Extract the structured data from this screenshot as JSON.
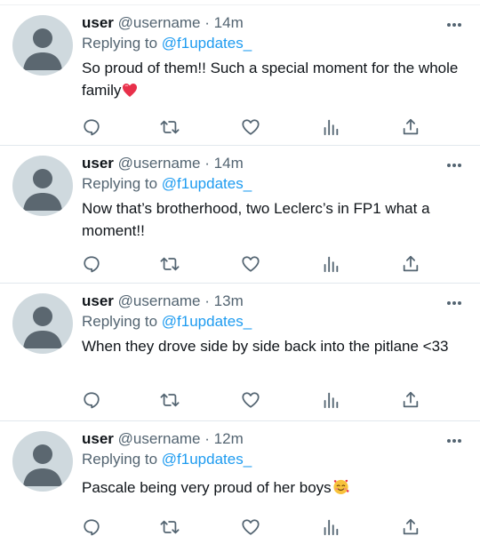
{
  "tweets": [
    {
      "name": "user",
      "handle": "@username",
      "dot": "·",
      "time": "14m",
      "reply_prefix": "Replying to",
      "reply_to": "@f1updates_",
      "text": "So proud of them!! Such a special moment for the whole family",
      "emoji": "red-heart"
    },
    {
      "name": "user",
      "handle": "@username",
      "dot": "·",
      "time": "14m",
      "reply_prefix": "Replying to",
      "reply_to": "@f1updates_",
      "text": "Now that’s brotherhood, two Leclerc’s in FP1 what a moment!!",
      "emoji": ""
    },
    {
      "name": "user",
      "handle": "@username",
      "dot": "·",
      "time": "13m",
      "reply_prefix": "Replying to",
      "reply_to": "@f1updates_",
      "text": "When they drove side by side back into the pitlane <33",
      "emoji": ""
    },
    {
      "name": "user",
      "handle": "@username",
      "dot": "·",
      "time": "12m",
      "reply_prefix": "Replying to",
      "reply_to": "@f1updates_",
      "text": "Pascale being very proud of her boys",
      "emoji": "smiling-face-with-hearts"
    }
  ],
  "icons": {
    "more": "more-horizontal-icon",
    "reply": "reply-icon",
    "retweet": "retweet-icon",
    "like": "heart-icon",
    "views": "views-icon",
    "share": "share-icon"
  },
  "colors": {
    "text": "#0f1419",
    "secondary": "#536471",
    "mention": "#1d9bf0",
    "avatar_bg": "#cfd9de",
    "avatar_fg": "#5b6770",
    "divider": "#e1e8ed"
  }
}
